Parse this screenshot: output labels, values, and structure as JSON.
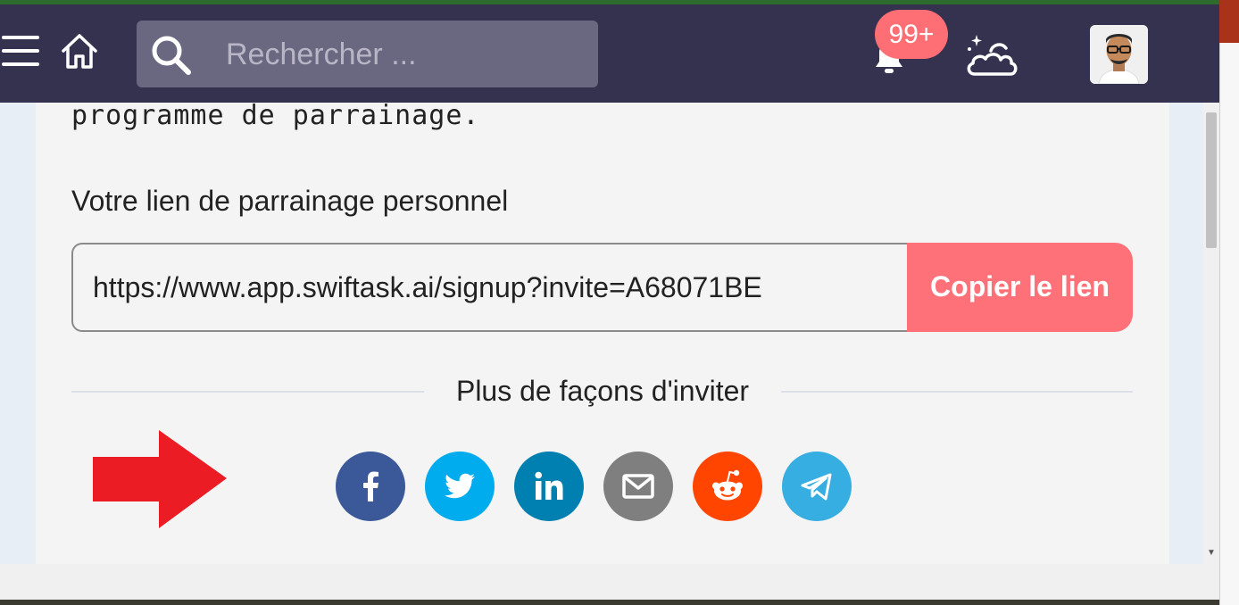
{
  "navbar": {
    "search": {
      "placeholder": "Rechercher ..."
    },
    "notifications": {
      "badge": "99+"
    }
  },
  "content": {
    "intro_text": "programme de parrainage.",
    "link_label": "Votre lien de parrainage personnel",
    "referral_link": "https://www.app.swiftask.ai/signup?invite=A68071BE",
    "copy_button": "Copier le lien",
    "more_ways": "Plus de façons d'inviter"
  },
  "share_buttons": [
    {
      "name": "facebook",
      "icon": "facebook-icon",
      "color": "#3b5998"
    },
    {
      "name": "twitter",
      "icon": "twitter-icon",
      "color": "#00aced"
    },
    {
      "name": "linkedin",
      "icon": "linkedin-icon",
      "color": "#007fb1"
    },
    {
      "name": "email",
      "icon": "email-icon",
      "color": "#7f7f7f"
    },
    {
      "name": "reddit",
      "icon": "reddit-icon",
      "color": "#ff4500"
    },
    {
      "name": "telegram",
      "icon": "telegram-icon",
      "color": "#37aee2"
    }
  ],
  "colors": {
    "navbar": "#35324f",
    "accent": "#ff7179",
    "arrow": "#ec1c24"
  }
}
